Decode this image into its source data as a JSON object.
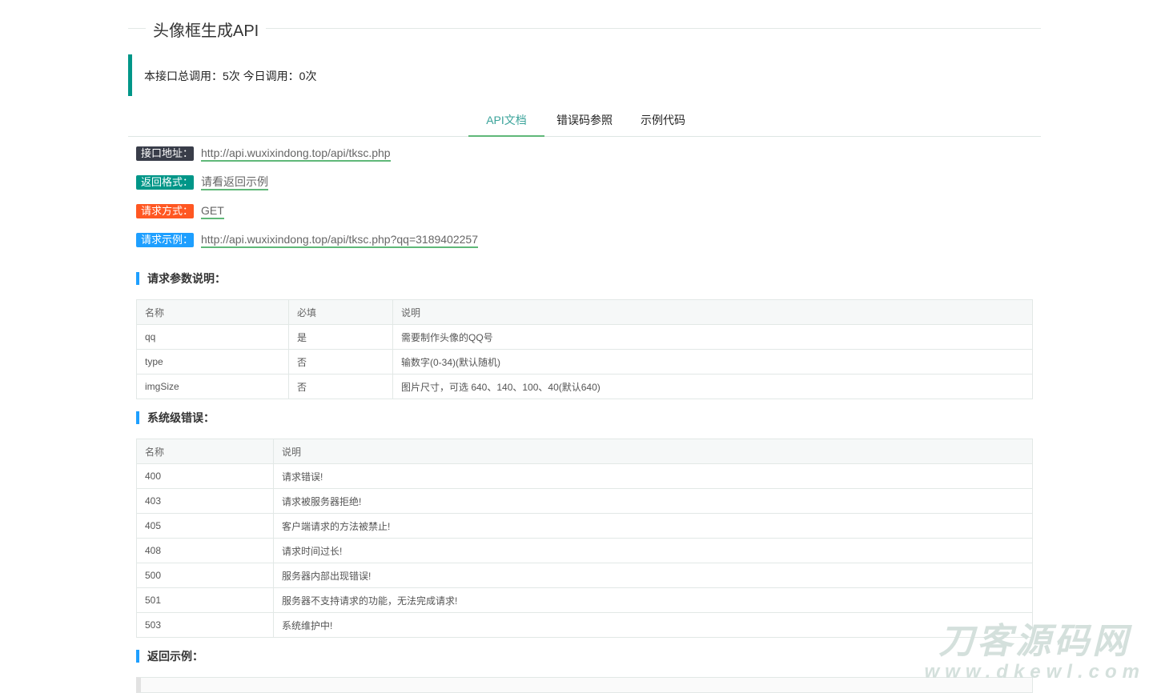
{
  "title": "头像框生成API",
  "stats": "本接口总调用：5次 今日调用：0次",
  "tabs": [
    "API文档",
    "错误码参照",
    "示例代码"
  ],
  "info": [
    {
      "label": "接口地址：",
      "value": "http://api.wuxixindong.top/api/tksc.php",
      "color": "#393d49"
    },
    {
      "label": "返回格式：",
      "value": "请看返回示例",
      "color": "#009688"
    },
    {
      "label": "请求方式：",
      "value": "GET",
      "color": "#ff5722"
    },
    {
      "label": "请求示例：",
      "value": "http://api.wuxixindong.top/api/tksc.php?qq=3189402257",
      "color": "#1e9fff"
    }
  ],
  "params": {
    "heading": "请求参数说明：",
    "headers": [
      "名称",
      "必填",
      "说明"
    ],
    "rows": [
      [
        "qq",
        "是",
        "需要制作头像的QQ号"
      ],
      [
        "type",
        "否",
        "输数字(0-34)(默认随机)"
      ],
      [
        "imgSize",
        "否",
        "图片尺寸，可选 640、140、100、40(默认640)"
      ]
    ]
  },
  "errors": {
    "heading": "系统级错误：",
    "headers": [
      "名称",
      "说明"
    ],
    "rows": [
      [
        "400",
        "请求错误!"
      ],
      [
        "403",
        "请求被服务器拒绝!"
      ],
      [
        "405",
        "客户端请求的方法被禁止!"
      ],
      [
        "408",
        "请求时间过长!"
      ],
      [
        "500",
        "服务器内部出现错误!"
      ],
      [
        "501",
        "服务器不支持请求的功能，无法完成请求!"
      ],
      [
        "503",
        "系统维护中!"
      ]
    ]
  },
  "return_heading": "返回示例：",
  "watermark": {
    "line1": "刀客源码网",
    "line2": "www.dkewl.com"
  }
}
